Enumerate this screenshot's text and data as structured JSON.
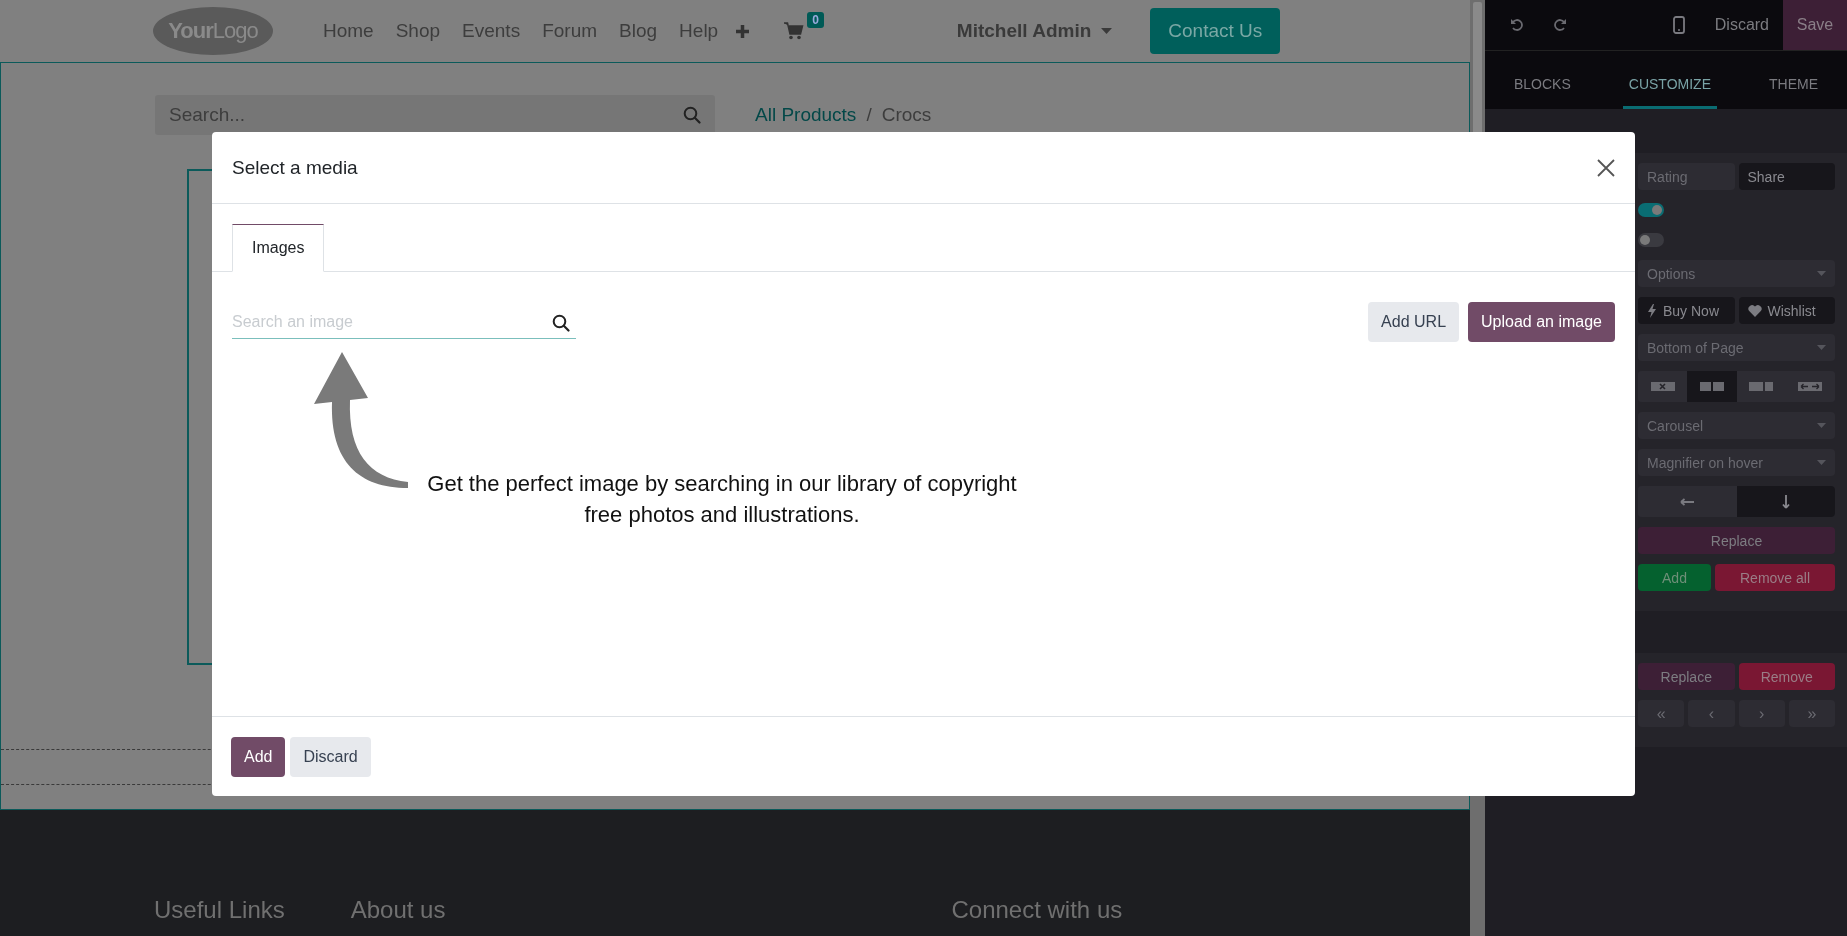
{
  "header": {
    "logo": "**Your**Logo",
    "nav": [
      "Home",
      "Shop",
      "Events",
      "Forum",
      "Blog",
      "Help"
    ],
    "cart_count": "0",
    "user": "Mitchell Admin",
    "cta": "Contact Us"
  },
  "shop": {
    "search_placeholder": "Search...",
    "breadcrumb": [
      "All Products",
      "Crocs"
    ],
    "breadcrumb_separator": "/"
  },
  "footer": {
    "headings": [
      "Useful Links",
      "About us",
      "Connect with us"
    ]
  },
  "editor": {
    "discard": "Discard",
    "save": "Save",
    "tabs": [
      {
        "label": "BLOCKS",
        "selected": false
      },
      {
        "label": "CUSTOMIZE",
        "selected": true
      },
      {
        "label": "THEME",
        "selected": false
      }
    ],
    "sections": [
      [
        {
          "kind": "pair",
          "items": [
            {
              "label": "Rating",
              "selected": false
            },
            {
              "label": "Share",
              "selected": true
            }
          ]
        },
        {
          "kind": "toggle",
          "on": true
        },
        {
          "kind": "toggle",
          "on": false
        },
        {
          "kind": "select",
          "value": "Options"
        },
        {
          "kind": "actions",
          "items": [
            {
              "label": "Buy Now",
              "selected": true
            },
            {
              "label": "Wishlist",
              "selected": true
            }
          ]
        },
        {
          "kind": "select",
          "value": "Bottom of Page"
        },
        {
          "kind": "layout-group",
          "items": [
            {
              "selected": false
            },
            {
              "selected": true
            },
            {
              "selected": false
            },
            {
              "selected": false
            }
          ]
        },
        {
          "kind": "select",
          "value": "Carousel"
        },
        {
          "kind": "select",
          "value": "Magnifier on hover"
        },
        {
          "kind": "direction-group",
          "items": [
            {
              "selected": false
            },
            {
              "selected": true
            }
          ]
        },
        {
          "kind": "replace",
          "items": [
            {
              "label": "Replace"
            }
          ]
        },
        {
          "kind": "add-remove",
          "items": [
            {
              "label": "Add"
            },
            {
              "label": "Remove all"
            }
          ]
        }
      ],
      [
        {
          "kind": "replace-remove",
          "items": [
            {
              "label": "Replace"
            },
            {
              "label": "Remove"
            }
          ]
        },
        {
          "kind": "pager",
          "items": [
            {
              "label": "«"
            },
            {
              "label": "‹"
            },
            {
              "label": "›"
            },
            {
              "label": "»"
            }
          ]
        }
      ]
    ]
  },
  "modal": {
    "title": "Select a media",
    "tabs": [
      {
        "label": "Images",
        "selected": true
      }
    ],
    "search_placeholder": "Search an image",
    "actions": [
      "Add URL",
      "Upload an image"
    ],
    "hint": "Get the perfect image by searching in our library of copyright free photos and illustrations.",
    "buttons": [
      "Add",
      "Discard"
    ]
  }
}
